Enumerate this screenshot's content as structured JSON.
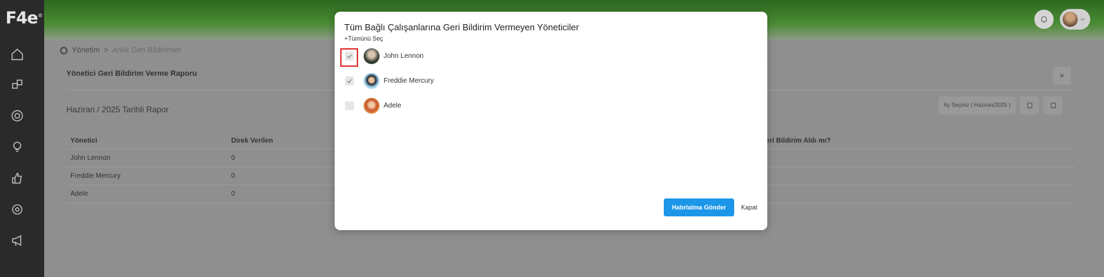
{
  "app": {
    "logo": "F4e",
    "logo_sup": "®"
  },
  "sidebar": {
    "icons": [
      "home-icon",
      "cubes-icon",
      "target-icon",
      "lightbulb-icon",
      "thumbs-up-icon",
      "settings-icon",
      "megaphone-icon"
    ]
  },
  "breadcrumb": {
    "root": "Yönetim",
    "separator": ">",
    "current": "Anlık Geri Bildirimler"
  },
  "report": {
    "title": "Yönetici Geri Bildirim Verme Raporu",
    "close": "×",
    "subtitle": "Haziran / 2025 Tarihli Rapor",
    "month_button": "Ay Seçiniz ( Haziran/2025 )",
    "columns": [
      "Yönetici",
      "Direk Verilen",
      "Geri Bildirim Aldı mı?"
    ],
    "rows": [
      {
        "name": "John Lennon",
        "direct": "0"
      },
      {
        "name": "Freddie Mercury",
        "direct": "0"
      },
      {
        "name": "Adele",
        "direct": "0"
      }
    ]
  },
  "modal": {
    "title": "Tüm Bağlı Çalışanlarına Geri Bildirim Vermeyen Yöneticiler",
    "select_all": "+Tümünü Seç",
    "people": [
      {
        "name": "John Lennon",
        "checked": true
      },
      {
        "name": "Freddie Mercury",
        "checked": true
      },
      {
        "name": "Adele",
        "checked": false
      }
    ],
    "send_button": "Hatırlatma Gönder",
    "close_link": "Kapat"
  },
  "colors": {
    "primary": "#1c96e8",
    "highlight": "#e03030",
    "sidebar": "#2a2a2a"
  }
}
